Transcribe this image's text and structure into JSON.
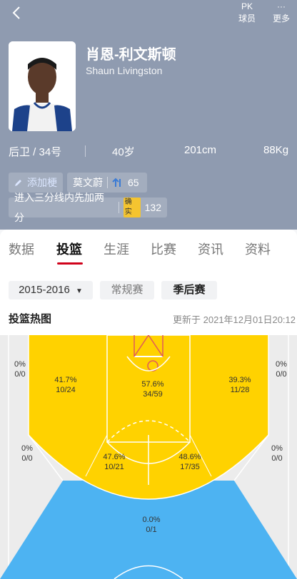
{
  "header": {
    "back_icon": "back-chevron-icon",
    "actions": [
      {
        "label": "球员",
        "icon": "pk-icon",
        "icon_text": "PK"
      },
      {
        "label": "更多",
        "icon": "more-dots-icon",
        "icon_text": "···"
      }
    ]
  },
  "player": {
    "name_cn": "肖恩-利文斯顿",
    "name_en": "Shaun Livingston",
    "position": "后卫 / 34号",
    "age": "40岁",
    "height": "201cm",
    "weight": "88Kg"
  },
  "tags": {
    "add_label": "添加梗",
    "tag1_name": "莫文蔚",
    "tag1_count": "65",
    "tag2_name": "进入三分线内先加两分",
    "tag2_badge": "确实",
    "tag2_count": "132"
  },
  "tabs": [
    "数据",
    "投篮",
    "生涯",
    "比赛",
    "资讯",
    "资料"
  ],
  "active_tab": "投篮",
  "filters": {
    "season": "2015-2016",
    "regular": "常规赛",
    "playoffs": "季后赛"
  },
  "heatmap": {
    "title": "投篮热图",
    "updated": "更新于 2021年12月01日20:12",
    "colors": {
      "hot": "#ffd200",
      "cold": "#4db3f2",
      "neutral": "#ececec"
    },
    "zones": [
      {
        "pct": "0%",
        "made": "0/0"
      },
      {
        "pct": "41.7%",
        "made": "10/24"
      },
      {
        "pct": "57.6%",
        "made": "34/59"
      },
      {
        "pct": "39.3%",
        "made": "11/28"
      },
      {
        "pct": "0%",
        "made": "0/0"
      },
      {
        "pct": "0%",
        "made": "0/0"
      },
      {
        "pct": "47.6%",
        "made": "10/21"
      },
      {
        "pct": "48.6%",
        "made": "17/35"
      },
      {
        "pct": "0%",
        "made": "0/0"
      },
      {
        "pct": "0.0%",
        "made": "0/1"
      }
    ]
  }
}
